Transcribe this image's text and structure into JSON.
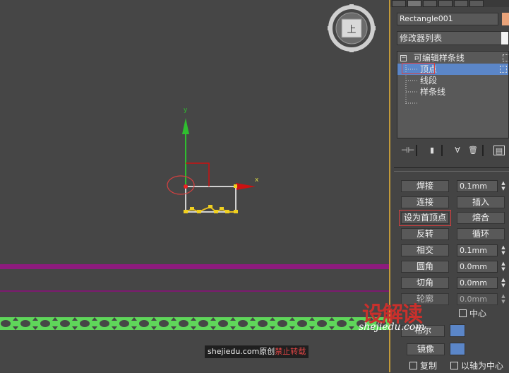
{
  "viewport": {
    "navcube_label": "上",
    "gizmo_x": "x",
    "gizmo_y": "y"
  },
  "panel": {
    "object_name": "Rectangle001",
    "swatch_color": "#e9a37a",
    "modifier_list": "修改器列表",
    "stack": {
      "root": "可编辑样条线",
      "items": [
        "顶点",
        "线段",
        "样条线"
      ]
    },
    "geometry": {
      "weld": "焊接",
      "weld_value": "0.1mm",
      "connect": "连接",
      "insert": "插入",
      "make_first": "设为首顶点",
      "fuse": "熔合",
      "reverse": "反转",
      "cycle": "循环",
      "intersect": "相交",
      "intersect_value": "0.1mm",
      "fillet": "圆角",
      "fillet_value": "0.0mm",
      "chamfer": "切角",
      "chamfer_value": "0.0mm",
      "outline": "轮廓",
      "outline_value": "0.0mm",
      "center": "中心",
      "boolean": "布尔",
      "mirror": "镜像",
      "copy": "复制",
      "about_pivot": "以轴为中心"
    }
  },
  "watermark": {
    "brand": "设解读",
    "url": "shejiedu.com",
    "bar_site": "shejiedu.com原创",
    "bar_warn": "禁止转载"
  },
  "colors": {
    "selection": "#5b86c8",
    "highlight": "#d84040",
    "accent": "#c29a3a"
  }
}
